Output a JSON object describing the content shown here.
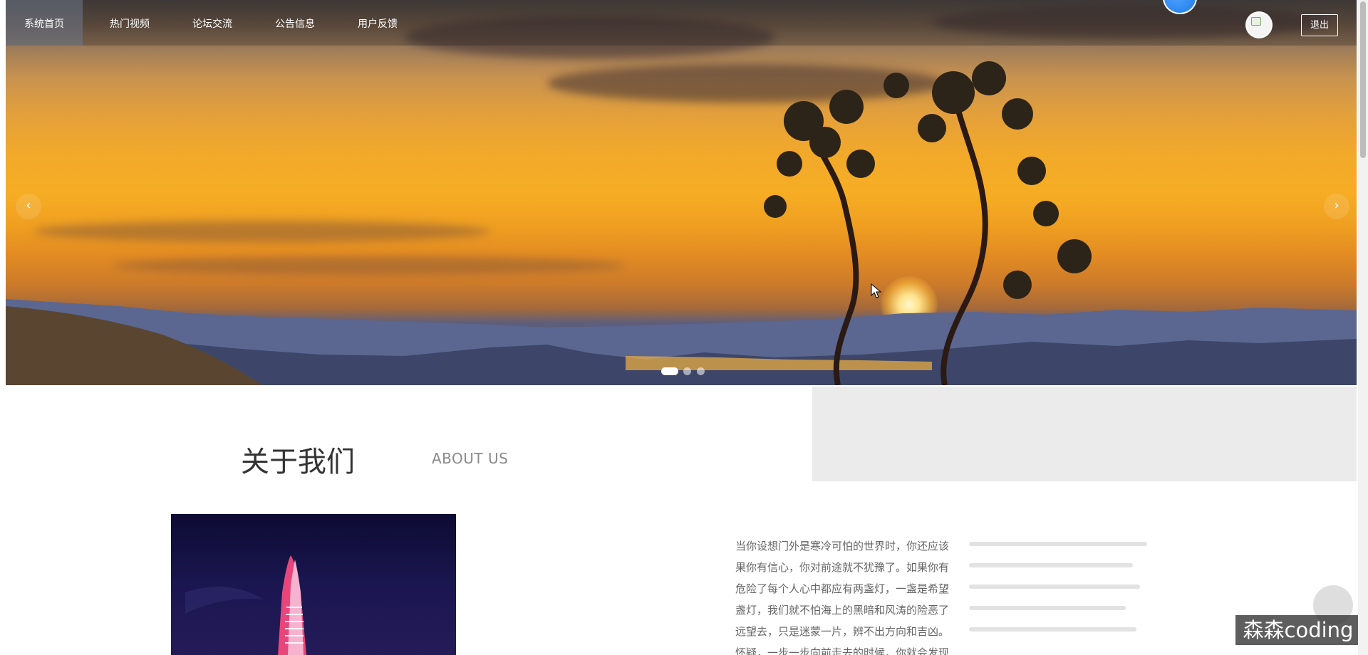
{
  "nav": {
    "items": [
      {
        "label": "系统首页",
        "active": true
      },
      {
        "label": "热门视频",
        "active": false
      },
      {
        "label": "论坛交流",
        "active": false
      },
      {
        "label": "公告信息",
        "active": false
      },
      {
        "label": "用户反馈",
        "active": false
      }
    ],
    "logout_label": "退出",
    "avatar_icon": "user-avatar-icon"
  },
  "carousel": {
    "prev_glyph": "‹",
    "next_glyph": "›",
    "slide_count": 3,
    "active_slide": 1
  },
  "about": {
    "title": "关于我们",
    "subtitle": "ABOUT US",
    "paragraph_lines": [
      "当你设想门外是寒冷可怕的世界时，你还应该",
      "果你有信心，你对前途就不犹豫了。如果你有",
      "危险了每个人心中都应有两盏灯，一盏是希望",
      "盏灯，我们就不怕海上的黑暗和风涛的险恶了",
      "远望去，只是迷蒙一片，辨不出方向和吉凶。",
      "怀疑，一步一步向前走去的时候，你就会发现"
    ]
  },
  "watermark": "森森coding",
  "colors": {
    "nav_active_bg": "#6e788c",
    "gray_panel": "#ebebeb",
    "body_text": "#666666"
  }
}
